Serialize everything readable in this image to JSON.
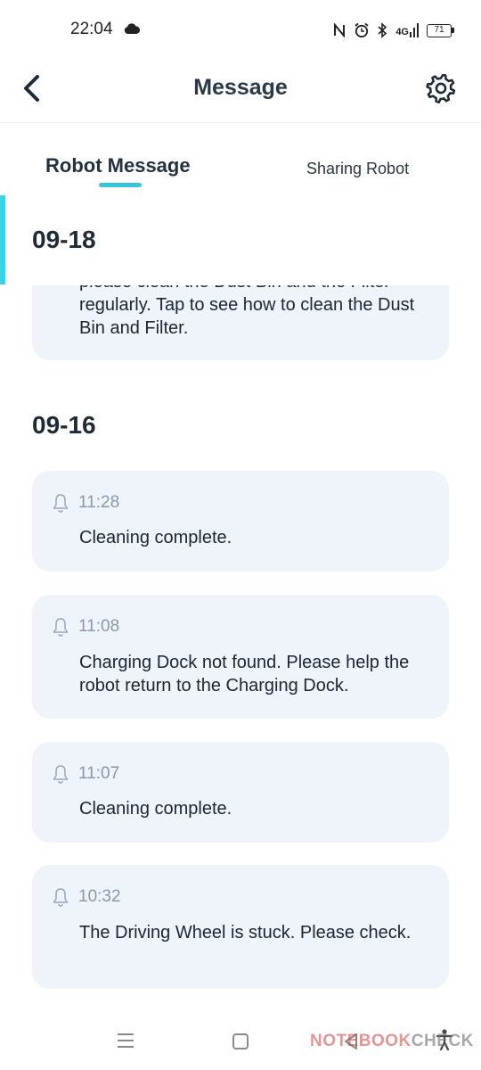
{
  "status_bar": {
    "time": "22:04",
    "signal": "4G",
    "battery": "71"
  },
  "header": {
    "title": "Message"
  },
  "tabs": [
    {
      "label": "Robot Message",
      "active": true
    },
    {
      "label": "Sharing Robot",
      "active": false
    }
  ],
  "groups": [
    {
      "date": "09-18",
      "messages": [
        {
          "time": "",
          "text": "please clean the Dust Bin and the Filter regularly. Tap to see how to clean the Dust Bin and Filter."
        }
      ]
    },
    {
      "date": "09-16",
      "messages": [
        {
          "time": "11:28",
          "text": "Cleaning complete."
        },
        {
          "time": "11:08",
          "text": "Charging Dock not found. Please help the robot return to the Charging Dock."
        },
        {
          "time": "11:07",
          "text": "Cleaning complete."
        },
        {
          "time": "10:32",
          "text": "The Driving Wheel is stuck. Please check."
        }
      ]
    }
  ],
  "watermark": {
    "part1": "NOTEBOOK",
    "part2": "CHECK"
  },
  "colors": {
    "accent": "#36c6d9",
    "card_background": "#eff3fa",
    "time_text": "#8a99aa"
  },
  "icons": {
    "back": "chevron-left-icon",
    "settings": "gear-icon",
    "message": "bell-icon"
  }
}
